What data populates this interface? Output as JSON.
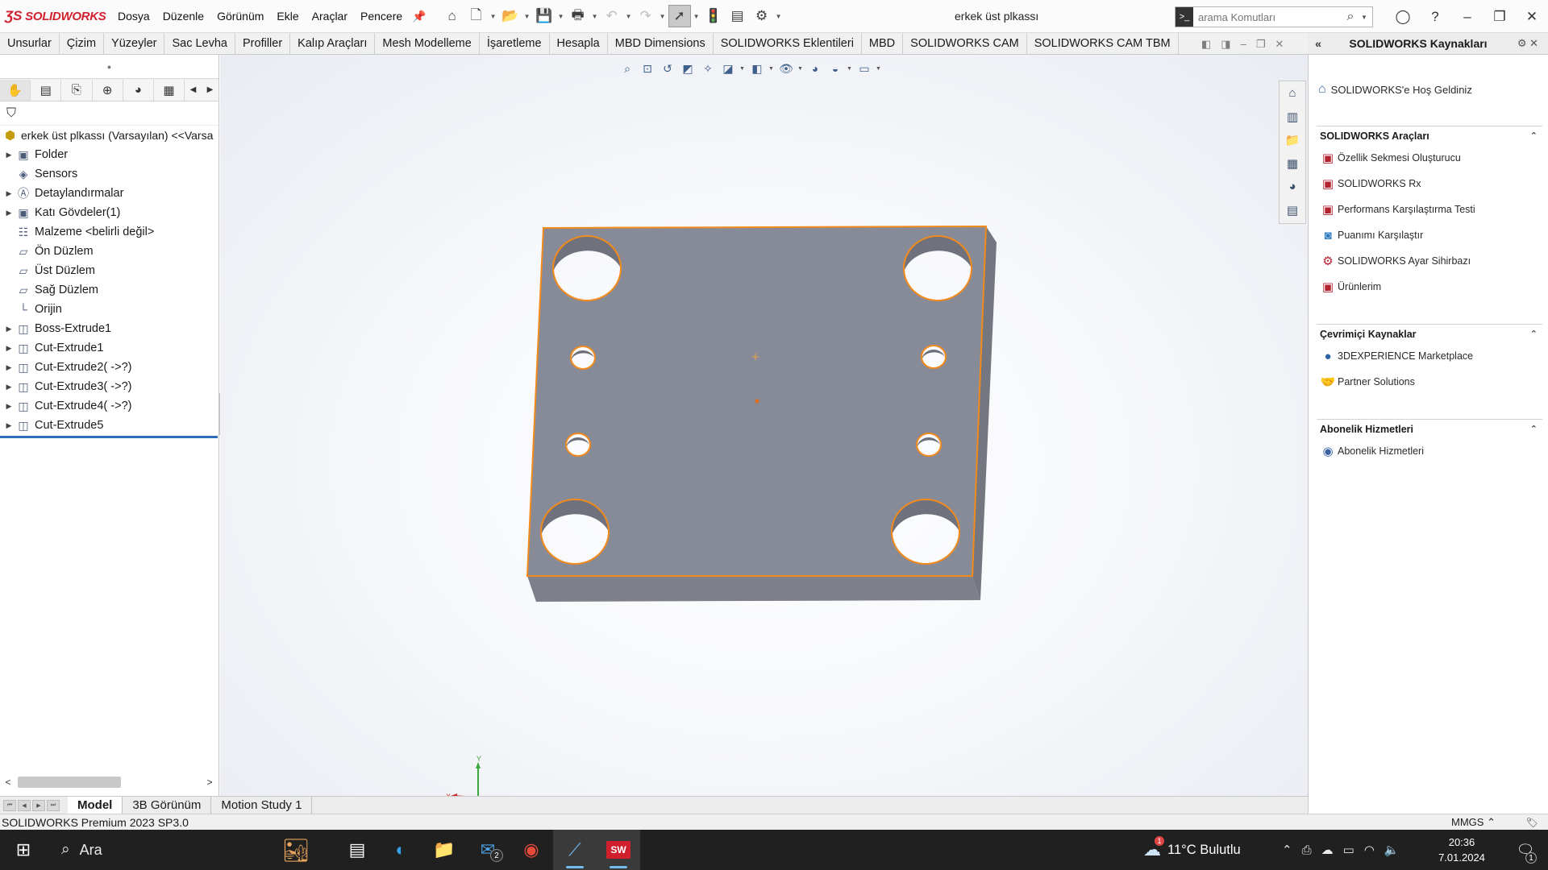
{
  "app": {
    "logo_text": "SOLIDWORKS",
    "menus": [
      "Dosya",
      "Düzenle",
      "Görünüm",
      "Ekle",
      "Araçlar",
      "Pencere"
    ],
    "document_title": "erkek üst plkassı",
    "search_placeholder": "arama Komutları"
  },
  "command_tabs": [
    "Unsurlar",
    "Çizim",
    "Yüzeyler",
    "Sac Levha",
    "Profiller",
    "Kalıp Araçları",
    "Mesh Modelleme",
    "İşaretleme",
    "Hesapla",
    "MBD Dimensions",
    "SOLIDWORKS Eklentileri",
    "MBD",
    "SOLIDWORKS CAM",
    "SOLIDWORKS CAM TBM"
  ],
  "feature_tree": {
    "root": "erkek üst plkassı (Varsayılan) <<Varsa",
    "items": [
      {
        "label": "Folder",
        "expandable": true,
        "icon": "folder-icon"
      },
      {
        "label": "Sensors",
        "expandable": false,
        "icon": "sensor-icon"
      },
      {
        "label": "Detaylandırmalar",
        "expandable": true,
        "icon": "annotation-icon"
      },
      {
        "label": "Katı Gövdeler(1)",
        "expandable": true,
        "icon": "solid-bodies-icon"
      },
      {
        "label": "Malzeme <belirli değil>",
        "expandable": false,
        "icon": "material-icon"
      },
      {
        "label": "Ön Düzlem",
        "expandable": false,
        "icon": "plane-icon"
      },
      {
        "label": "Üst Düzlem",
        "expandable": false,
        "icon": "plane-icon"
      },
      {
        "label": "Sağ Düzlem",
        "expandable": false,
        "icon": "plane-icon"
      },
      {
        "label": "Orijin",
        "expandable": false,
        "icon": "origin-icon"
      },
      {
        "label": "Boss-Extrude1",
        "expandable": true,
        "icon": "boss-extrude-icon"
      },
      {
        "label": "Cut-Extrude1",
        "expandable": true,
        "icon": "cut-extrude-icon"
      },
      {
        "label": "Cut-Extrude2( ->?)",
        "expandable": true,
        "icon": "cut-extrude-icon"
      },
      {
        "label": "Cut-Extrude3( ->?)",
        "expandable": true,
        "icon": "cut-extrude-icon"
      },
      {
        "label": "Cut-Extrude4( ->?)",
        "expandable": true,
        "icon": "cut-extrude-icon"
      },
      {
        "label": "Cut-Extrude5",
        "expandable": true,
        "icon": "cut-extrude-icon"
      }
    ]
  },
  "resources": {
    "header": "SOLIDWORKS Kaynakları",
    "welcome": "SOLIDWORKS'e Hoş Geldiniz",
    "sections": [
      {
        "title": "SOLIDWORKS Araçları",
        "items": [
          "Özellik Sekmesi Oluşturucu",
          "SOLIDWORKS Rx",
          "Performans Karşılaştırma Testi",
          "Puanımı Karşılaştır",
          "SOLIDWORKS Ayar Sihirbazı",
          "Ürünlerim"
        ]
      },
      {
        "title": "Çevrimiçi Kaynaklar",
        "items": [
          "3DEXPERIENCE Marketplace",
          "Partner Solutions"
        ]
      },
      {
        "title": "Abonelik Hizmetleri",
        "items": [
          "Abonelik Hizmetleri"
        ]
      }
    ]
  },
  "bottom_tabs": [
    "Model",
    "3B Görünüm",
    "Motion Study 1"
  ],
  "triad": {
    "y": "Y",
    "x": "X"
  },
  "status": {
    "left": "SOLIDWORKS Premium 2023 SP3.0",
    "units": "MMGS"
  },
  "taskbar": {
    "search": "Ara",
    "mail_badge": "2",
    "weather_text": "11°C  Bulutlu",
    "weather_badge": "1",
    "time": "20:36",
    "date": "7.01.2024",
    "notifications": "1"
  },
  "colors": {
    "part_face": "#878b98",
    "part_side": "#777a85",
    "selection_edge": "#f28a1c",
    "brand_red": "#d01f2d"
  }
}
